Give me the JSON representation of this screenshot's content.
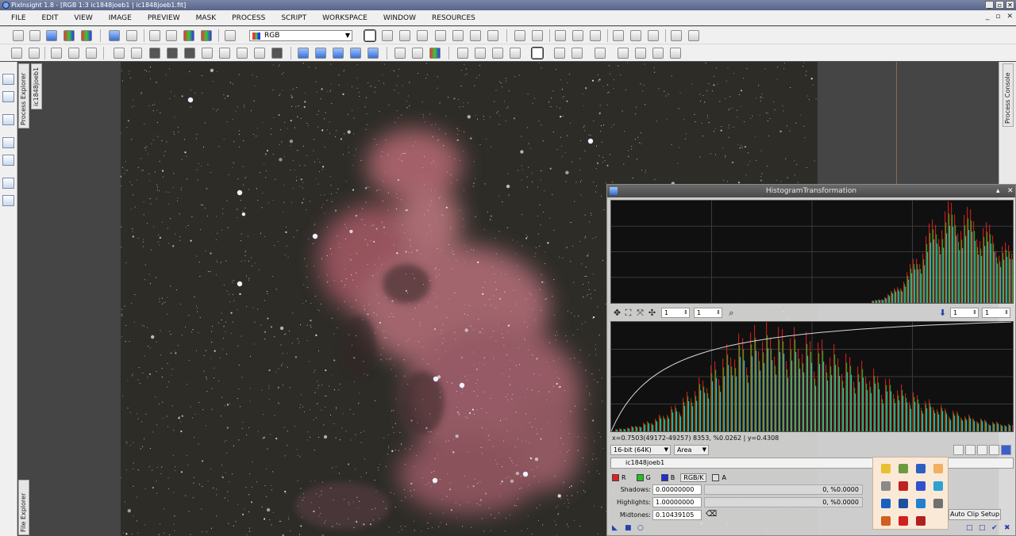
{
  "window": {
    "title": "PixInsight 1.8 - [RGB 1:3 ic1848joeb1 | ic1848joeb1.fit]",
    "controls": [
      "_",
      "▫",
      "✕"
    ]
  },
  "menubar": {
    "items": [
      "FILE",
      "EDIT",
      "VIEW",
      "IMAGE",
      "PREVIEW",
      "MASK",
      "PROCESS",
      "SCRIPT",
      "WORKSPACE",
      "WINDOW",
      "RESOURCES"
    ],
    "mdi_controls": [
      "_",
      "▫",
      "✕"
    ]
  },
  "toolbar": {
    "channel_select": "RGB"
  },
  "sidetabs": {
    "process_explorer": "Process Explorer",
    "view_tab": "ic1848joeb1",
    "file_explorer": "File Explorer",
    "process_console": "Process Console"
  },
  "histogram": {
    "title": "HistogramTransformation",
    "zoom_h": "1",
    "zoom_v": "1",
    "zoom_h2": "1",
    "zoom_v2": "1",
    "readout": "x=0.7503(49172-49257) 8353, %0.0262 | y=0.4308",
    "resolution": "16-bit (64K)",
    "mode": "Area",
    "view": "ic1848joeb1",
    "channels": {
      "r": "R",
      "g": "G",
      "b": "B",
      "rgbk": "RGB/K",
      "a": "A"
    },
    "shadows": {
      "label": "Shadows:",
      "value": "0.00000000",
      "clip": "0, %0.0000"
    },
    "highlights": {
      "label": "Highlights:",
      "value": "1.00000000",
      "clip": "0, %0.0000"
    },
    "midtones": {
      "label": "Midtones:",
      "value": "0.10439105"
    },
    "auto_clip": "Auto Clip Setup"
  },
  "colors": {
    "nebula": "#b5606b",
    "starfield": "#2b2a26",
    "histogram_bg": "#101010",
    "channel_red": "#e02020",
    "channel_green": "#20c020",
    "channel_cyan": "#40c8e0"
  }
}
